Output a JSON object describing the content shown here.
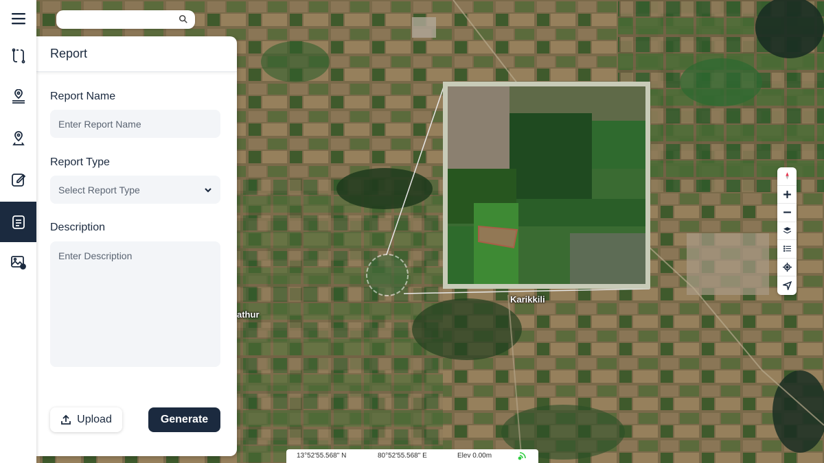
{
  "search": {
    "placeholder": ""
  },
  "rail": {
    "items": [
      {
        "icon": "menu-icon"
      },
      {
        "icon": "route-icon"
      },
      {
        "icon": "location-pin-icon"
      },
      {
        "icon": "route-pin-icon"
      },
      {
        "icon": "edit-icon"
      },
      {
        "icon": "report-icon",
        "active": true
      },
      {
        "icon": "image-settings-icon"
      }
    ]
  },
  "panel": {
    "title": "Report",
    "report_name": {
      "label": "Report Name",
      "placeholder": "Enter Report Name"
    },
    "report_type": {
      "label": "Report Type",
      "placeholder": "Select Report Type"
    },
    "description": {
      "label": "Description",
      "placeholder": "Enter Description"
    },
    "upload_label": "Upload",
    "generate_label": "Generate"
  },
  "map": {
    "places": [
      "Karikkili",
      "athur"
    ]
  },
  "map_tools": [
    "compass-icon",
    "zoom-in-icon",
    "zoom-out-icon",
    "layers-icon",
    "legend-icon",
    "locate-icon",
    "navigate-icon"
  ],
  "status": {
    "lat": "13°52'55.568\" N",
    "lon": "80°52'55.568\" E",
    "elev": "Elev 0.00m"
  },
  "colors": {
    "primary": "#1b2a3f",
    "highlight": "#e8304a",
    "gps": "#2ecc40"
  }
}
